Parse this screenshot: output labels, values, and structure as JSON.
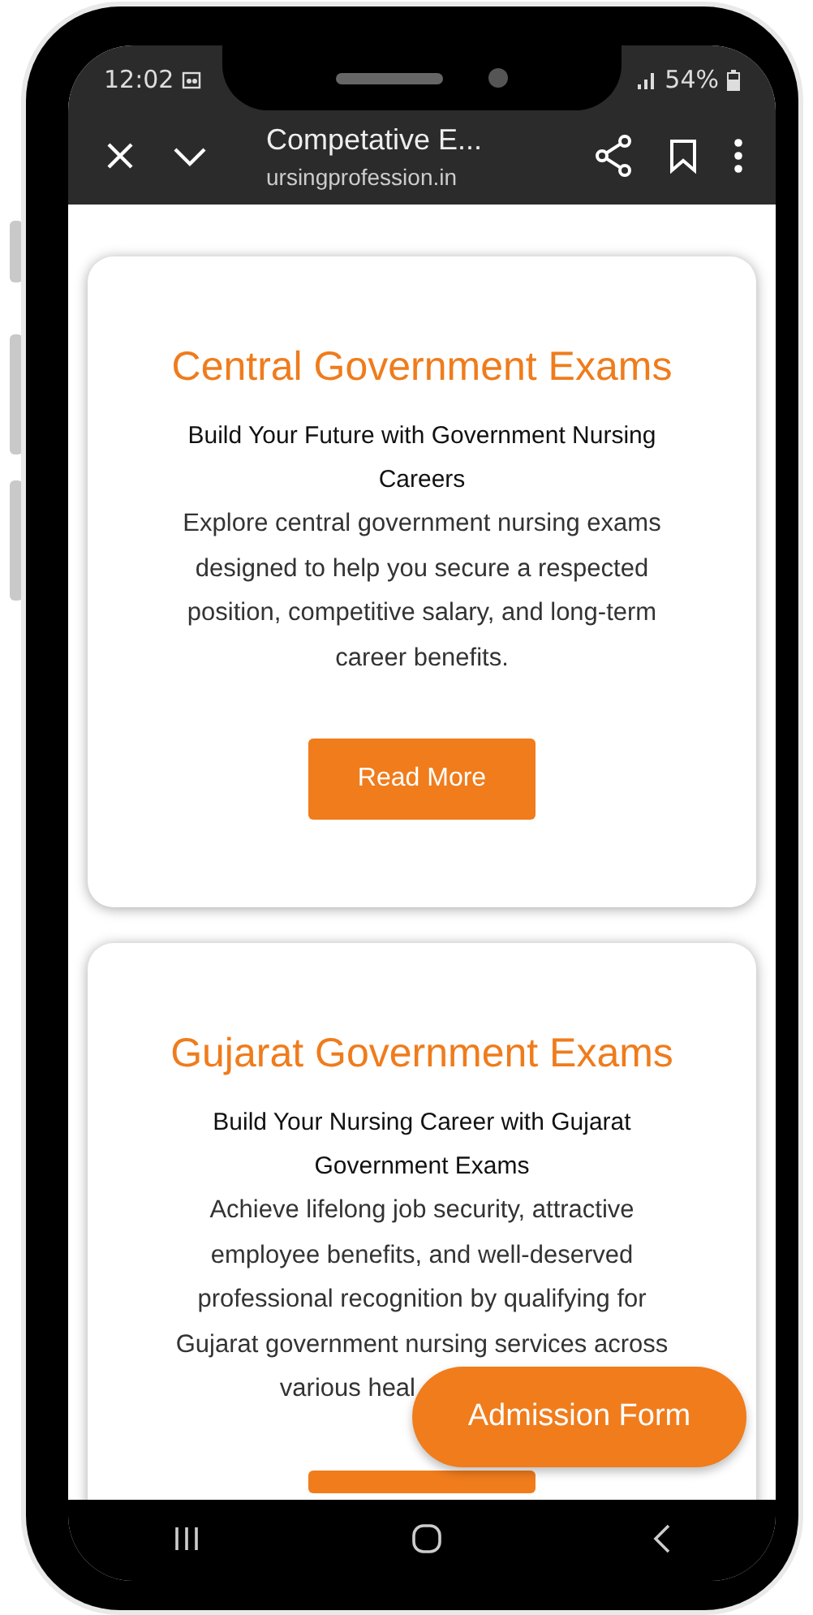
{
  "status_bar": {
    "time": "12:02",
    "battery": "54%"
  },
  "toolbar": {
    "title": "Competative E...",
    "url": "ursingprofession.in"
  },
  "cards": [
    {
      "title": "Central Government Exams",
      "subtitle": "Build Your Future with Government Nursing Careers",
      "text": "Explore central government nursing exams designed to help you secure a respected position, competitive salary, and long-term career benefits.",
      "button": {
        "kind": "full",
        "label": "Read More"
      }
    },
    {
      "title": "Gujarat Government Exams",
      "subtitle": "Build Your Nursing Career with Gujarat Government Exams",
      "text": "Achieve lifelong job security, attractive employee benefits, and well-deserved professional recognition by qualifying for Gujarat government nursing services across",
      "text_tail": "various heal",
      "button": {
        "kind": "cut"
      }
    }
  ],
  "floating_button": {
    "label": "Admission Form"
  }
}
